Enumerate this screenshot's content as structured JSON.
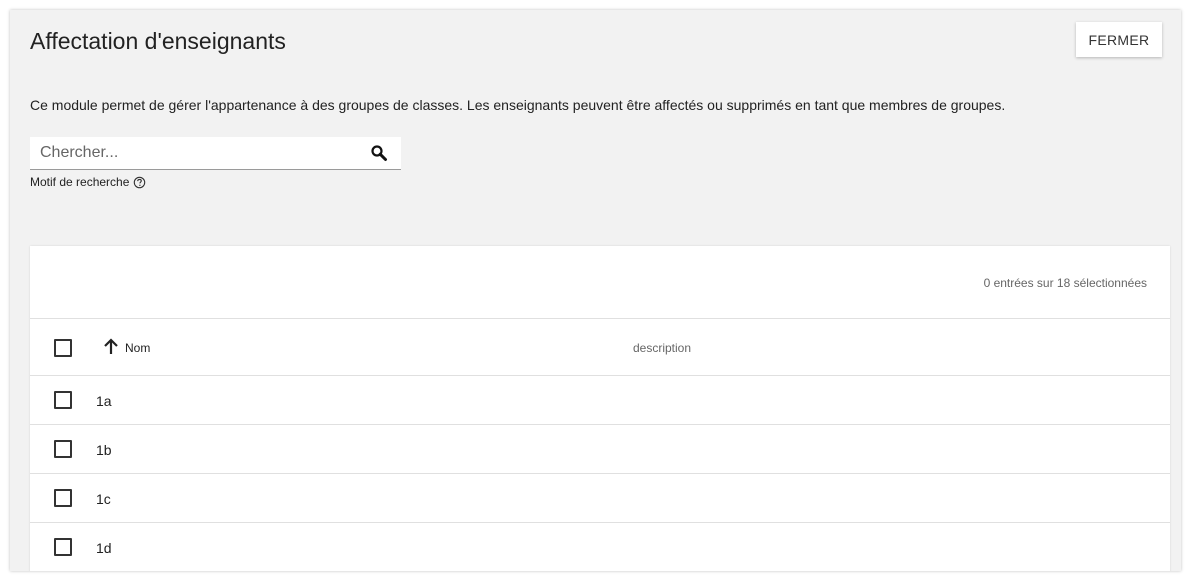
{
  "dialog": {
    "title": "Affectation d'enseignants",
    "close_label": "FERMER",
    "description": "Ce module permet de gérer l'appartenance à des groupes de classes. Les enseignants peuvent être affectés ou supprimés en tant que membres de groupes."
  },
  "search": {
    "placeholder": "Chercher...",
    "value": "",
    "hint": "Motif de recherche",
    "icon": "search-icon",
    "hint_icon": "help-circle-icon"
  },
  "grid": {
    "status": "0 entrées sur 18 sélectionnées",
    "columns": {
      "name": "Nom",
      "description": "description"
    },
    "sort_icon": "arrow-up-icon",
    "rows": [
      {
        "name": "1a",
        "description": "",
        "selected": false
      },
      {
        "name": "1b",
        "description": "",
        "selected": false
      },
      {
        "name": "1c",
        "description": "",
        "selected": false
      },
      {
        "name": "1d",
        "description": "",
        "selected": false
      }
    ]
  }
}
